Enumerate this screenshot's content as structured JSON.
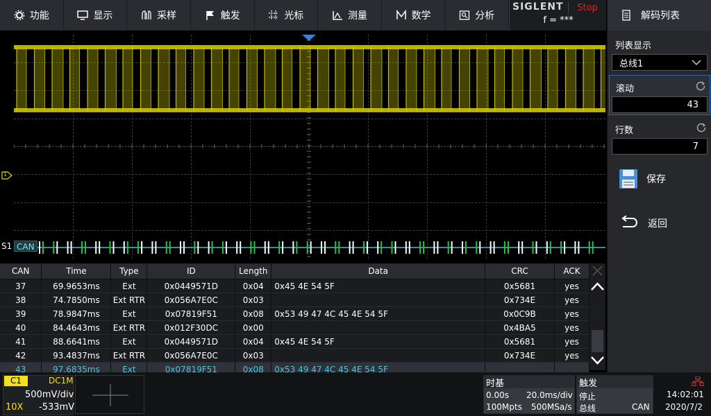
{
  "menu": [
    {
      "icon": "gear-icon",
      "label": "功能"
    },
    {
      "icon": "display-icon",
      "label": "显示"
    },
    {
      "icon": "acquire-icon",
      "label": "采样"
    },
    {
      "icon": "flag-icon",
      "label": "触发"
    },
    {
      "icon": "cursor-icon",
      "label": "光标"
    },
    {
      "icon": "measure-icon",
      "label": "测量"
    },
    {
      "icon": "math-icon",
      "label": "数学"
    },
    {
      "icon": "analysis-icon",
      "label": "分析"
    }
  ],
  "brand": {
    "logo": "SIGLENT",
    "status": "Stop",
    "freq": "f = ***"
  },
  "panel": {
    "title": "解码列表",
    "list_display_label": "列表显示",
    "list_display_value": "总线1",
    "scroll_label": "滚动",
    "scroll_value": "43",
    "rows_label": "行数",
    "rows_value": "7",
    "save_label": "保存",
    "back_label": "返回"
  },
  "waveform": {
    "bus_label": "S1",
    "bus_name": "CAN",
    "channel_marker": "1",
    "colors": {
      "c1": "#d8d000",
      "bus_green": "#27c24a",
      "bus_cyan": "#40c0d8",
      "bus_white": "#ffffff"
    }
  },
  "table": {
    "headers": [
      "CAN",
      "Time",
      "Type",
      "ID",
      "Length",
      "Data",
      "CRC",
      "ACK"
    ],
    "rows": [
      [
        "37",
        "69.9653ms",
        "Ext",
        "0x0449571D",
        "0x04",
        "0x45 4E 54 5F",
        "0x5681",
        "yes"
      ],
      [
        "38",
        "74.7850ms",
        "Ext RTR",
        "0x056A7E0C",
        "0x03",
        "",
        "0x734E",
        "yes"
      ],
      [
        "39",
        "78.9847ms",
        "Ext",
        "0x07819F51",
        "0x08",
        "0x53 49 47 4C 45 4E 54 5F",
        "0x0C9B",
        "yes"
      ],
      [
        "40",
        "84.4643ms",
        "Ext RTR",
        "0x012F30DC",
        "0x00",
        "",
        "0x4BA5",
        "yes"
      ],
      [
        "41",
        "88.6641ms",
        "Ext",
        "0x0449571D",
        "0x04",
        "0x45 4E 54 5F",
        "0x5681",
        "yes"
      ],
      [
        "42",
        "93.4837ms",
        "Ext RTR",
        "0x056A7E0C",
        "0x03",
        "",
        "0x734E",
        "yes"
      ],
      [
        "43",
        "97.6835ms",
        "Ext",
        "0x07819F51",
        "0x08",
        "0x53 49 47 4C 45 4E 54 5F",
        "",
        ""
      ]
    ],
    "selected_row": 6
  },
  "bottom": {
    "ch1": {
      "label": "C1",
      "coupling": "DC1M",
      "scale": "500mV/div",
      "probe": "10X",
      "offset": "-533mV"
    },
    "timebase": {
      "title": "时基",
      "delay": "0.00s",
      "scale": "20.0ms/div",
      "memory": "100Mpts",
      "rate": "500MSa/s"
    },
    "trigger": {
      "title": "触发",
      "state": "停止",
      "source_label": "总线",
      "source": "CAN"
    },
    "clock": {
      "time": "14:02:01",
      "date": "2020/7/2"
    }
  }
}
